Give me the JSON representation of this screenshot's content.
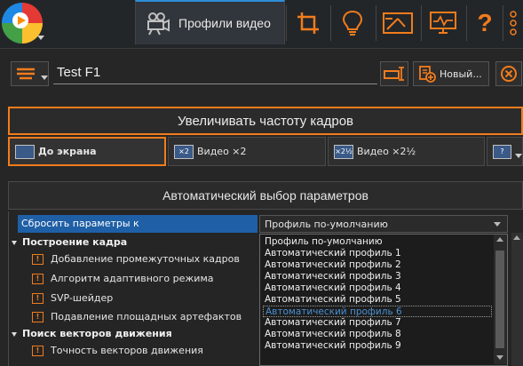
{
  "toolbar": {
    "active_tab_label": "Профили видео",
    "help_label": "?",
    "icons": [
      "film-camera-icon",
      "crop-icon",
      "lightbulb-icon",
      "aspect-icon",
      "monitor-icon",
      "help-icon",
      "more-icon"
    ]
  },
  "profile": {
    "name": "Test F1",
    "new_button_label": "Новый..."
  },
  "frame_rate_button_label": "Увеличивать частоту кадров",
  "modes": [
    {
      "label": "До экрана",
      "icon_text": "",
      "selected": true
    },
    {
      "label": "Видео ×2",
      "icon_text": "×2",
      "selected": false
    },
    {
      "label": "Видео ×2½",
      "icon_text": "×2½",
      "selected": false
    },
    {
      "label": "",
      "icon_text": "?",
      "selected": false
    }
  ],
  "auto_params_label": "Автоматический выбор параметров",
  "reset": {
    "label": "Сбросить параметры к",
    "value": "Профиль по-умолчанию"
  },
  "groups": [
    {
      "label": "Построение кадра",
      "items": [
        "Добавление промежуточных кадров",
        "Алгоритм адаптивного режима",
        "SVP-шейдер",
        "Подавление площадных артефактов"
      ]
    },
    {
      "label": "Поиск векторов движения",
      "items": [
        "Точность векторов движения"
      ]
    }
  ],
  "dropdown_options": [
    "Профиль по-умолчанию",
    "Автоматический профиль 1",
    "Автоматический профиль 2",
    "Автоматический профиль 3",
    "Автоматический профиль 4",
    "Автоматический профиль 5",
    "Автоматический профиль 6",
    "Автоматический профиль 7",
    "Автоматический профиль 8",
    "Автоматический профиль 9"
  ],
  "dropdown_highlighted_index": 6,
  "colors": {
    "accent": "#f27c1c",
    "selection": "#1f5fa6",
    "background": "#262626"
  }
}
